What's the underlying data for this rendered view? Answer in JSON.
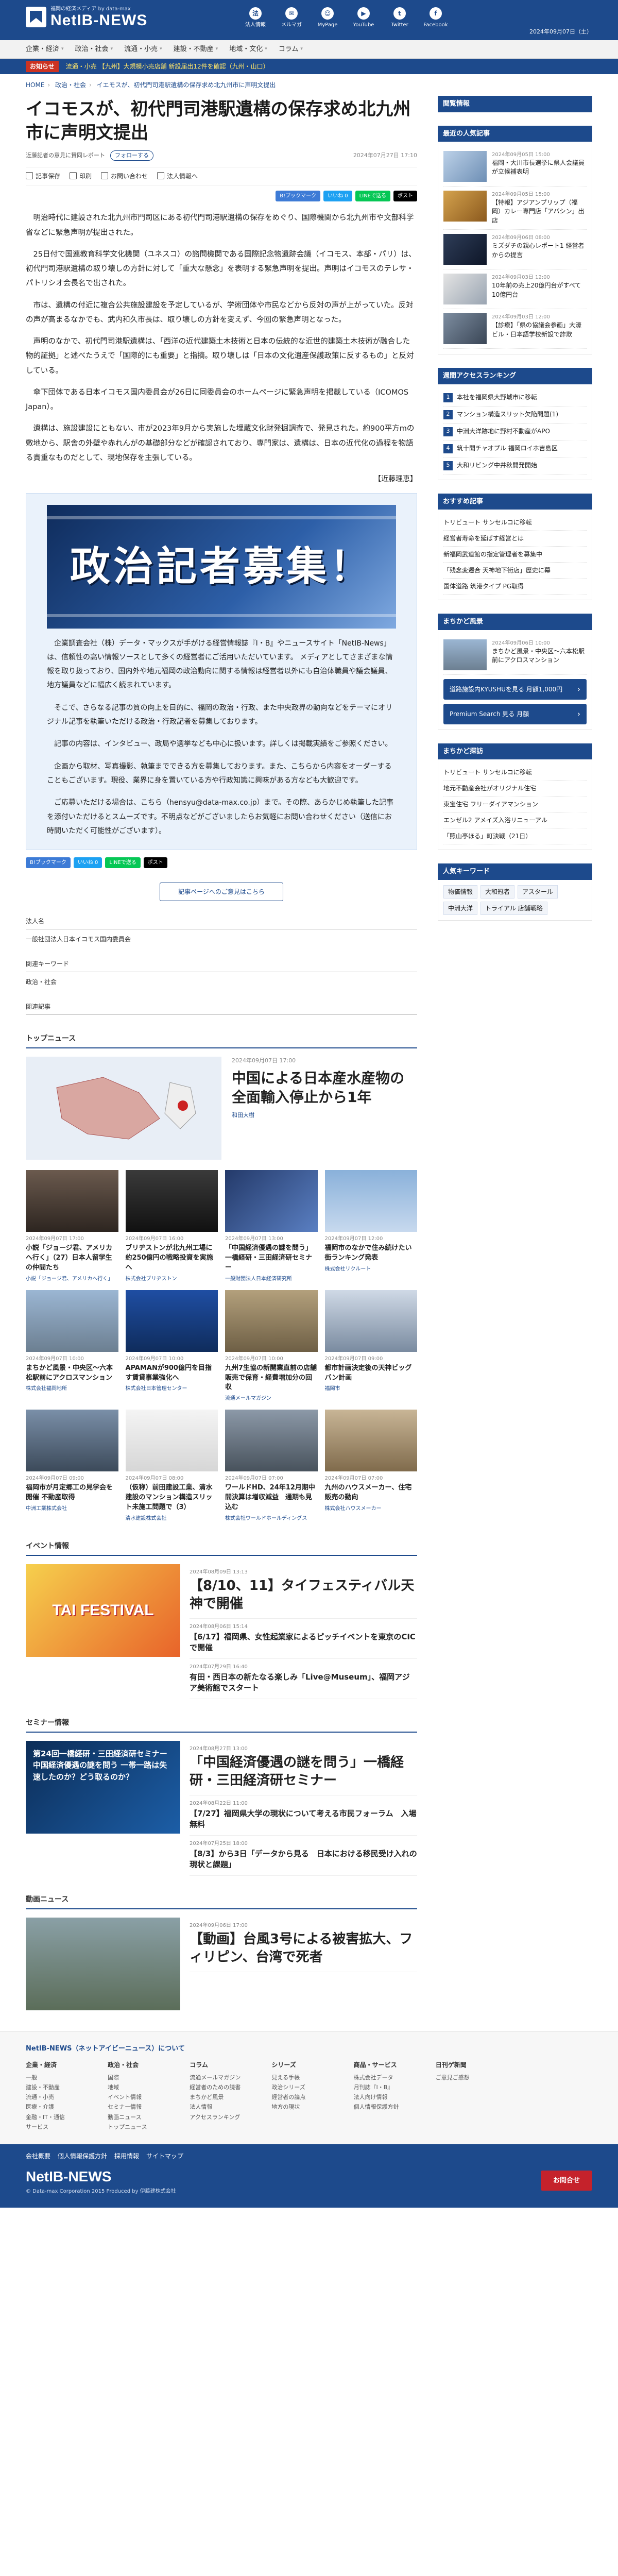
{
  "header": {
    "tagline": "福岡の経済メディア by data-max",
    "brand": "NetIB-NEWS",
    "icons": [
      {
        "icon": "members-icon",
        "label": "法人情報"
      },
      {
        "icon": "mail-icon",
        "label": "メルマガ"
      },
      {
        "icon": "user-icon",
        "label": "MyPage"
      },
      {
        "icon": "youtube-icon",
        "label": "YouTube"
      },
      {
        "icon": "twitter-icon",
        "label": "Twitter"
      },
      {
        "icon": "facebook-icon",
        "label": "Facebook"
      }
    ],
    "date": "2024年09月07日（土）"
  },
  "nav": [
    "企業・経済",
    "政治・社会",
    "流通・小売",
    "建設・不動産",
    "地域・文化",
    "コラム"
  ],
  "ticker": {
    "label": "お知らせ",
    "msg": "流通・小売 【九州】大規模小売店舗 新設届出12件を確認（九州・山口）"
  },
  "breadcrumb": [
    "HOME",
    "政治・社会",
    "イエモスが、初代門司港駅遺構の保存求め北九州市に声明文提出"
  ],
  "article": {
    "title": "イコモスが、初代門司港駅遺構の保存求め北九州市に声明文提出",
    "author": "近藤記者の意見に賛同レポート",
    "follow": "フォローする",
    "date": "2024年07月27日 17:10",
    "actions": [
      "記事保存",
      "印刷",
      "お問い合わせ",
      "法人情報へ"
    ],
    "shares": [
      "B!ブックマーク",
      "いいね 0",
      "LINEで送る",
      "ポスト"
    ],
    "paragraphs": [
      "明治時代に建設された北九州市門司区にある初代門司港駅遺構の保存をめぐり、国際機関から北九州市や文部科学省などに緊急声明が提出された。",
      "25日付で国連教育科学文化機関（ユネスコ）の諮問機関である国際記念物遺跡会議（イコモス、本部・パリ）は、初代門司港駅遺構の取り壊しの方針に対して「重大な懸念」を表明する緊急声明を提出。声明はイコモスのテレサ・パトリシオ会長名で出された。",
      "市は、遺構の付近に複合公共施設建設を予定しているが、学術団体や市民などから反対の声が上がっていた。反対の声が高まるなかでも、武内和久市長は、取り壊しの方針を変えず、今回の緊急声明となった。",
      "声明のなかで、初代門司港駅遺構は、「西洋の近代建築土木技術と日本の伝統的な近世的建築土木技術が融合した物的証拠」と述べたうえで「国際的にも重要」と指摘。取り壊しは「日本の文化遺産保護政策に反するもの」と反対している。",
      "傘下団体である日本イコモス国内委員会が26日に同委員会のホームページに緊急声明を掲載している（ICOMOS Japan）。",
      "遺構は、施設建設にともない、市が2023年9月から実施した埋蔵文化財発掘調査で、発見された。約900平方mの敷地から、駅舎の外壁や赤れんがの基礎部分などが確認されており、専門家は、遺構は、日本の近代化の過程を物語る貴重なものだとして、現地保存を主張している。"
    ],
    "signed": "【近藤理恵】"
  },
  "recruit": {
    "banner": "政治記者募集！",
    "paragraphs": [
      "企業調査会社（株）データ・マックスが手がける経営情報誌『I・B』やニュースサイト「NetIB-News」は、信頼性の高い情報ソースとして多くの経営者にご活用いただいています。 メディアとしてさまざまな情報を取り扱っており、国内外や地元福岡の政治動向に関する情報は経営者以外にも自治体職員や議会議員、地方議員などに幅広く読まれています。",
      "そこで、さらなる記事の質の向上を目的に、福岡の政治・行政、また中央政界の動向などをテーマにオリジナル記事を執筆いただける政治・行政記者を募集しております。",
      "記事の内容は、インタビュー、政局や選挙なども中心に扱います。詳しくは掲載実績をご参照ください。",
      "企画から取材、写真撮影、執筆までできる方を募集しております。また、こちらから内容をオーダーすることもございます。現役、業界に身を置いている方や行政知識に興味がある方なども大歓迎です。",
      "ご応募いただける場合は、こちら（hensyu@data-max.co.jp）まで。その際、あらかじめ執筆した記事を添付いただけるとスムーズです。不明点などがございましたらお気軽にお問い合わせください（送信にお時間いただく可能性がございます）。"
    ],
    "shares": [
      "B!ブックマーク",
      "いいね 0",
      "LINEで送る",
      "ポスト"
    ]
  },
  "more_button": "記事ページへのご意見はこちら",
  "company": {
    "label": "法人名",
    "value": "一般社団法人日本イコモス国内委員会"
  },
  "keywords": {
    "label": "関連キーワード",
    "value": "政治・社会"
  },
  "related": {
    "label": "関連記事"
  },
  "top_news": {
    "heading": "トップニュース",
    "feature": {
      "date": "2024年09月07日 17:00",
      "title": "中国による日本産水産物の全面輸入停止から1年",
      "source": "和田大樹"
    },
    "cards": [
      {
        "date": "2024年09月07日 17:00",
        "title": "小説「ジョージ君、アメリカへ行く」（27）日本人留学生の仲間たち",
        "source": "小説「ジョージ君、アメリカへ行く」"
      },
      {
        "date": "2024年09月07日 16:00",
        "title": "ブリヂストンが北九州工場に約250億円の戦略投資を実施へ",
        "source": "株式会社ブリヂストン"
      },
      {
        "date": "2024年09月07日 13:00",
        "title": "「中国経済優遇の謎を問う」一橋経研・三田経済研セミナー",
        "source": "一般財団法人日本経済研究所"
      },
      {
        "date": "2024年09月07日 12:00",
        "title": "福岡市のなかで住み続けたい街ランキング発表",
        "source": "株式会社リクルート"
      },
      {
        "date": "2024年09月07日 10:00",
        "title": "まちかど風景・中央区～六本松駅前にアクロスマンション",
        "source": "株式会社福岡地所"
      },
      {
        "date": "2024年09月07日 10:00",
        "title": "APAMANが900億円を目指す賃貸事業強化へ",
        "source": "株式会社日本管理センター"
      },
      {
        "date": "2024年09月07日 10:00",
        "title": "九州7生協の新開業直前の店舗販売で保育・経費増加分の回収",
        "source": "流通メールマガジン"
      },
      {
        "date": "2024年09月07日 09:00",
        "title": "都市計画決定後の天神ビッグバン計画",
        "source": "福岡市"
      },
      {
        "date": "2024年09月07日 09:00",
        "title": "福岡市が月定郷工の見学会を開催 不動産取得",
        "source": "中洲工業株式会社"
      },
      {
        "date": "2024年09月07日 08:00",
        "title": "（仮称）前田建設工業、清水建設のマンション構造スリット未施工問題で（3）",
        "source": "清水建設株式会社"
      },
      {
        "date": "2024年09月07日 07:00",
        "title": "ワールドHD、24年12月期中間決算は増収減益　通期も見込む",
        "source": "株式会社ワールドホールディングス"
      },
      {
        "date": "2024年09月07日 07:00",
        "title": "九州のハウスメーカー、住宅販売の動向",
        "source": "株式会社ハウスメーカー"
      }
    ]
  },
  "events": {
    "heading": "イベント情報",
    "banner": "TAI FESTIVAL",
    "items": [
      {
        "date": "2024年08月09日 13:13",
        "title": "【8/10、11】タイフェスティバル天神で開催",
        "big": true
      },
      {
        "date": "2024年08月06日 15:14",
        "title": "【6/17】福岡県、女性起業家によるピッチイベントを東京のCICで開催"
      },
      {
        "date": "2024年07月29日 16:40",
        "title": "有田・西日本の新たなる楽しみ「Live@Museum」、福岡アジア美術館でスタート"
      }
    ]
  },
  "seminars": {
    "heading": "セミナー情報",
    "banner": "第24回一橋経研・三田経済研セミナー 中国経済優遇の謎を問う 一帯一路は失速したのか？どう取るのか？",
    "items": [
      {
        "date": "2024年08月27日 13:00",
        "title": "「中国経済優遇の謎を問う」一橋経研・三田経済研セミナー",
        "big": true
      },
      {
        "date": "2024年08月22日 11:00",
        "title": "【7/27】福岡県大学の現状について考える市民フォーラム　入場無料"
      },
      {
        "date": "2024年07月25日 18:00",
        "title": "【8/3】から3日「データから見る　日本における移民受け入れの現状と課題」"
      }
    ]
  },
  "videos": {
    "heading": "動画ニュース",
    "items": [
      {
        "date": "2024年09月06日 17:00",
        "title": "【動画】台風3号による被害拡大、フィリピン、台湾で死者",
        "big": true
      }
    ]
  },
  "sidebar": {
    "ranking": {
      "heading": "閲覧情報"
    },
    "popular": {
      "heading": "最近の人気記事",
      "items": [
        {
          "date": "2024年09月05日 15:00",
          "title": "福岡・大川市長選挙に県人会議員が立候補表明"
        },
        {
          "date": "2024年09月05日 15:00",
          "title": "【特報】アジアンプリップ（福岡）カレー専門店「アバシン」出店"
        },
        {
          "date": "2024年09月06日 08:00",
          "title": "ミズダチの親心レポート1 経営者からの提言"
        },
        {
          "date": "2024年09月03日 12:00",
          "title": "10年前の売上20億円台がすべて10億円台"
        },
        {
          "date": "2024年09月03日 12:00",
          "title": "【診療】「県の協議会参画」大濠ビル・日本語学校新設で詐欺"
        }
      ]
    },
    "weekly": {
      "heading": "週間アクセスランキング",
      "items": [
        "本社を福岡県大野城市に移転",
        "マンション構造スリット欠陥問題(1)",
        "中洲大洋跡地に野村不動産がAPO",
        "筑十開チャオプル 福岡ロイホ吉島区",
        "大和リビング中井秋開発開始"
      ]
    },
    "recommend": {
      "heading": "おすすめ記事",
      "items": [
        "トリビュート サンセルコに移転",
        "経営者寿命を延ばす経営とは",
        "新福岡武道館の指定管理者を募集中",
        "「残念変遷合 天神地下街店」歴史に幕",
        "国体道路 筑港タイプ PG取得"
      ]
    },
    "street": {
      "heading": "まちかど風景",
      "items": [
        {
          "date": "2024年09月06日 10:00",
          "title": "まちかど風景・中央区～六本松駅前にアクロスマンション"
        }
      ],
      "buttons": [
        "道路施設内KYUSHUを見る 月額1,000円",
        "Premium Search 見る 月額"
      ]
    },
    "explore": {
      "heading": "まちかど探訪",
      "items": [
        "トリビュート サンセルコに移転",
        "地元不動産会社がオリジナル住宅",
        "東宝住宅 フリーダイアマンション",
        "エンゼル2 アメイズ入浴リニューアル",
        "「照山亭ほる」町決戦（21日）"
      ]
    },
    "keywords": {
      "heading": "人気キーワード",
      "items": [
        "物価情報",
        "大和冠者",
        "アスタール",
        "中洲大洋",
        "トライアル 店舗戦略"
      ]
    }
  },
  "footer": {
    "heading": "NetIB-NEWS（ネットアイビーニュース）について",
    "cols": [
      {
        "h": "企業・経済",
        "items": [
          "一般",
          "建設・不動産",
          "流通・小売",
          "医療・介護",
          "金融・IT・通信",
          "サービス"
        ]
      },
      {
        "h": "政治・社会",
        "items": [
          "国際",
          "地域",
          "イベント情報",
          "セミナー情報",
          "動画ニュース",
          "トップニュース"
        ]
      },
      {
        "h": "コラム",
        "items": [
          "流通メールマガジン",
          "経営者のための読書",
          "まちかど風景",
          "法人情報",
          "アクセスランキング"
        ]
      },
      {
        "h": "シリーズ",
        "items": [
          "見える手帳",
          "政治シリーズ",
          "経営者の論点",
          "地方の現状"
        ]
      },
      {
        "h": "商品・サービス",
        "items": [
          "株式会社データ",
          "月刊誌『I・B』",
          "法人向け情報",
          "個人情報保護方針"
        ]
      },
      {
        "h": "日刊ゲ新聞",
        "items": [
          "ご意見ご感想"
        ]
      },
      {
        "h": "",
        "items": []
      }
    ],
    "bar_links": [
      "会社概要",
      "個人情報保護方針",
      "採用情報",
      "サイトマップ"
    ],
    "brand": "NetIB-NEWS",
    "copy": "© Data-max Corporation 2015  Produced by 伊藤建株式会社",
    "ask": "お問合せ"
  }
}
